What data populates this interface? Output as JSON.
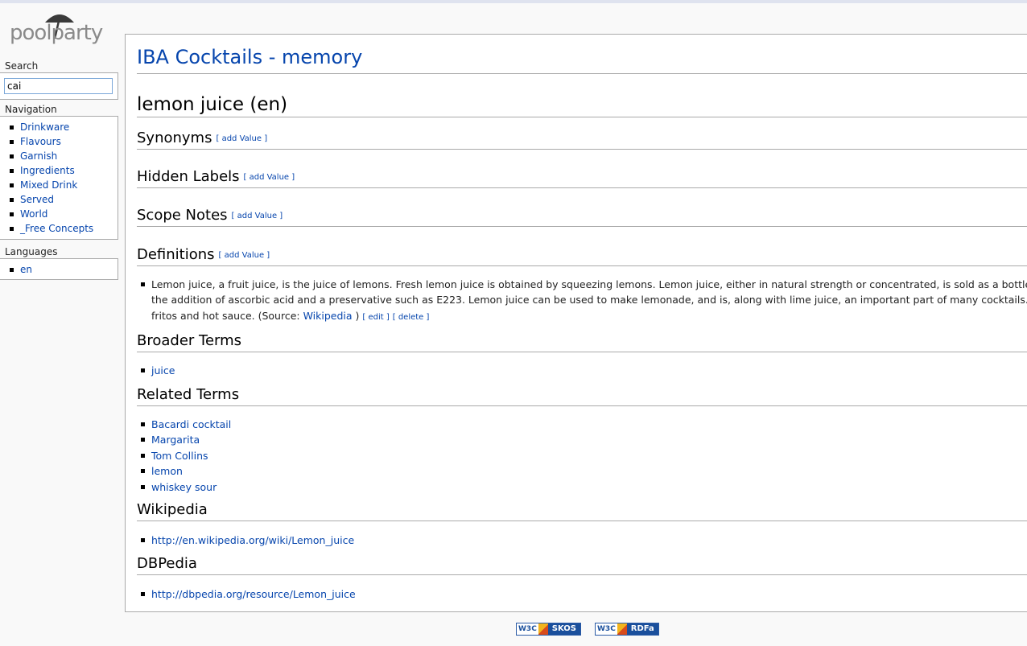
{
  "app": {
    "logo_text": "poolparty"
  },
  "sidebar": {
    "search": {
      "title": "Search",
      "value": "cai"
    },
    "navigation": {
      "title": "Navigation",
      "items": [
        "Drinkware",
        "Flavours",
        "Garnish",
        "Ingredients",
        "Mixed Drink",
        "Served",
        "World",
        "_Free Concepts"
      ]
    },
    "languages": {
      "title": "Languages",
      "items": [
        "en"
      ]
    }
  },
  "page": {
    "title": "IBA Cocktails - memory",
    "concept": "lemon juice (en)",
    "add_value_label": "[ add Value ]",
    "sections": {
      "synonyms": "Synonyms",
      "hidden_labels": "Hidden Labels",
      "scope_notes": "Scope Notes",
      "definitions": "Definitions",
      "broader": "Broader Terms",
      "related": "Related Terms",
      "wikipedia": "Wikipedia",
      "dbpedia": "DBPedia"
    },
    "definition": {
      "line1": "Lemon juice, a fruit juice, is the juice of lemons. Fresh lemon juice is obtained by squeezing lemons. Lemon juice, either in natural strength or concentrated, is sold as a bottled product mos",
      "line2": "the addition of ascorbic acid and a preservative such as E223. Lemon juice can be used to make lemonade, and is, along with lime juice, an important part of many cocktails. Lemon juice is",
      "line3_prefix": "fritos and hot sauce. (Source: ",
      "source_link": "Wikipedia",
      "line3_suffix": " )",
      "edit_label": "[ edit ]",
      "delete_label": "[ delete ]"
    },
    "broader_terms": [
      "juice"
    ],
    "related_terms": [
      "Bacardi cocktail",
      "Margarita",
      "Tom Collins",
      "lemon",
      "whiskey sour"
    ],
    "wikipedia_links": [
      "http://en.wikipedia.org/wiki/Lemon_juice"
    ],
    "dbpedia_links": [
      "http://dbpedia.org/resource/Lemon_juice"
    ]
  },
  "footer": {
    "badges": [
      {
        "w3c": "W3C",
        "label": "SKOS"
      },
      {
        "w3c": "W3C",
        "label": "RDFa"
      }
    ]
  },
  "colors": {
    "link": "#0645ad",
    "border": "#aaaaaa",
    "background": "#f9f9f9",
    "input_border": "#7aa7d8"
  }
}
